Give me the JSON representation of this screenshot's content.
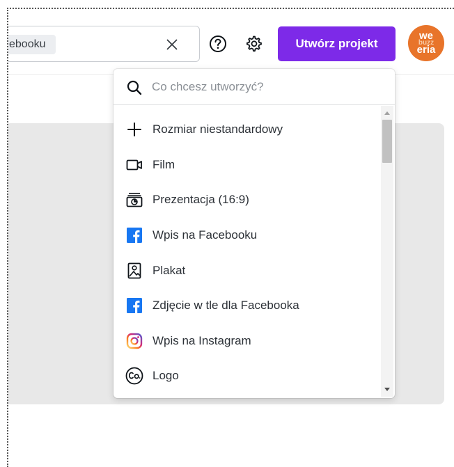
{
  "header": {
    "search_value": "ebooku",
    "clear_icon": "close-icon",
    "help_icon": "question-circle-icon",
    "settings_icon": "gear-icon",
    "create_button_label": "Utwórz projekt",
    "avatar": {
      "line1": "we",
      "line2": "buzz",
      "line3": "eria"
    }
  },
  "dropdown": {
    "search_placeholder": "Co chcesz utworzyć?",
    "items": [
      {
        "label": "Rozmiar niestandardowy",
        "icon": "plus-icon"
      },
      {
        "label": "Film",
        "icon": "video-camera-icon"
      },
      {
        "label": "Prezentacja (16:9)",
        "icon": "presentation-icon"
      },
      {
        "label": "Wpis na Facebooku",
        "icon": "facebook-icon"
      },
      {
        "label": "Plakat",
        "icon": "poster-icon"
      },
      {
        "label": "Zdjęcie w tle dla Facebooka",
        "icon": "facebook-icon"
      },
      {
        "label": "Wpis na Instagram",
        "icon": "instagram-icon"
      },
      {
        "label": "Logo",
        "icon": "logo-icon"
      }
    ]
  },
  "colors": {
    "accent": "#7d2ae8",
    "avatar_bg": "#e8742a",
    "facebook": "#1877f2",
    "panel_bg": "#e8e8e8"
  }
}
